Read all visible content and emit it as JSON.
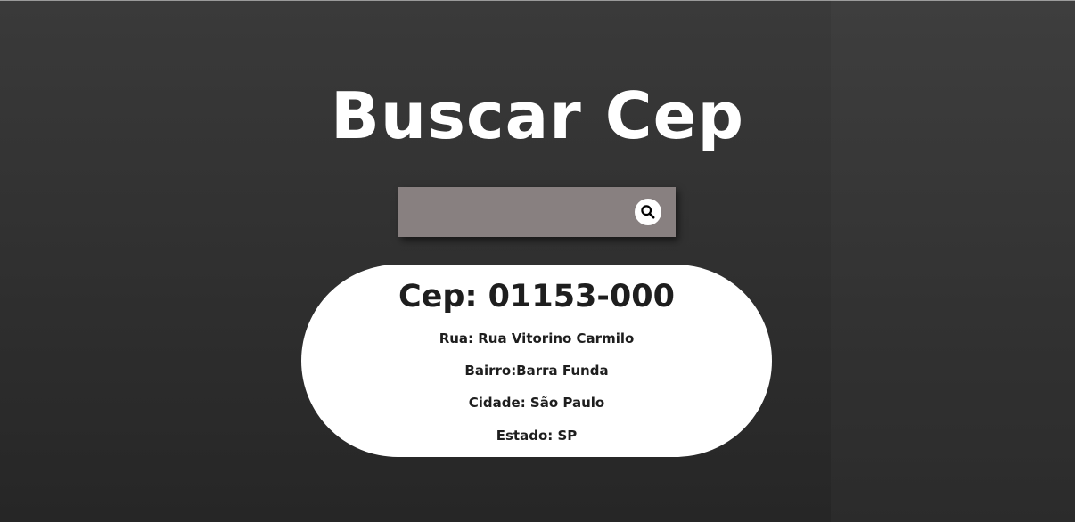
{
  "header": {
    "title": "Buscar Cep"
  },
  "search": {
    "value": "",
    "placeholder": "",
    "button_icon": "search-icon"
  },
  "result": {
    "cep_line": "Cep: 01153-000",
    "rua_line": "Rua: Rua Vitorino Carmilo",
    "bairro_line": "Bairro:Barra Funda",
    "cidade_line": "Cidade: São Paulo",
    "estado_line": "Estado: SP"
  },
  "colors": {
    "background_top": "#3a3a3a",
    "background_bottom": "#262626",
    "search_box": "#888080",
    "card": "#ffffff",
    "title_text": "#ffffff",
    "card_text": "#1e1e1e"
  }
}
